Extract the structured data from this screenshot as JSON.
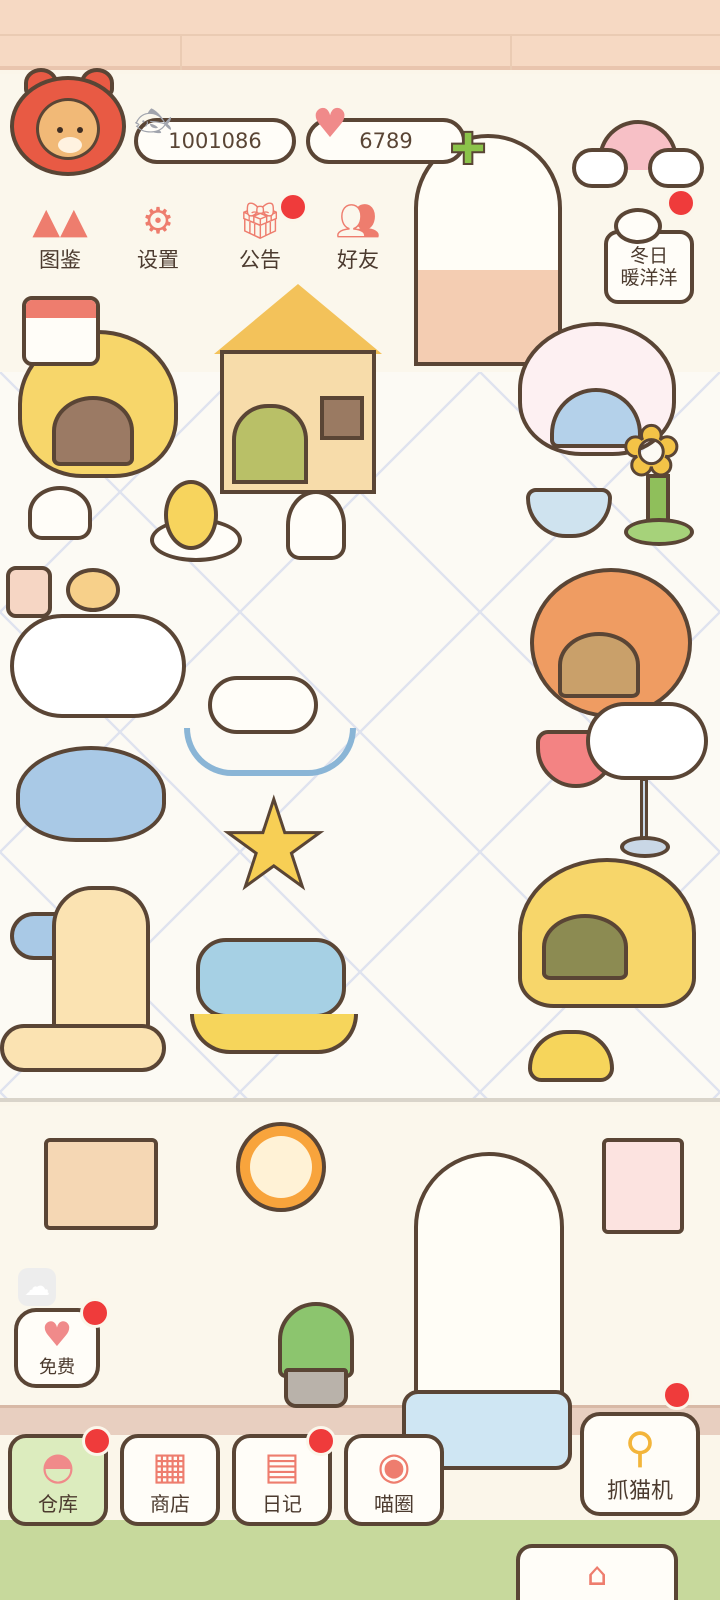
{
  "hud": {
    "coins": "1001086",
    "hearts": "6789",
    "coin_icon": "fish-icon",
    "heart_icon": "heart-icon",
    "add_icon": "plus-icon"
  },
  "menu": {
    "items": [
      {
        "label": "图鉴",
        "icon": "cat-head-icon",
        "has_badge": false
      },
      {
        "label": "设置",
        "icon": "gear-icon",
        "has_badge": false
      },
      {
        "label": "公告",
        "icon": "gift-icon",
        "has_badge": true
      },
      {
        "label": "好友",
        "icon": "friends-icon",
        "has_badge": false
      }
    ]
  },
  "event": {
    "line1": "冬日",
    "line2": "暖洋洋",
    "has_badge": true
  },
  "free": {
    "label": "免费",
    "icon": "heart-icon",
    "has_badge": true
  },
  "nav": {
    "items": [
      {
        "label": "仓库",
        "icon": "storage-icon",
        "active": true,
        "has_badge": true
      },
      {
        "label": "商店",
        "icon": "shop-icon",
        "active": false,
        "has_badge": false
      },
      {
        "label": "日记",
        "icon": "diary-icon",
        "active": false,
        "has_badge": true
      },
      {
        "label": "喵圈",
        "icon": "cat-planet-icon",
        "active": false,
        "has_badge": false
      }
    ],
    "claw": {
      "label": "抓猫机",
      "icon": "claw-icon",
      "has_badge": true
    },
    "home_icon": "house-icon"
  },
  "colors": {
    "badge": "#ef3b3b",
    "outline": "#5a4535",
    "background": "#fbf6ea",
    "accent_pink": "#ee7d6e",
    "active_tab": "#dcecbe"
  }
}
